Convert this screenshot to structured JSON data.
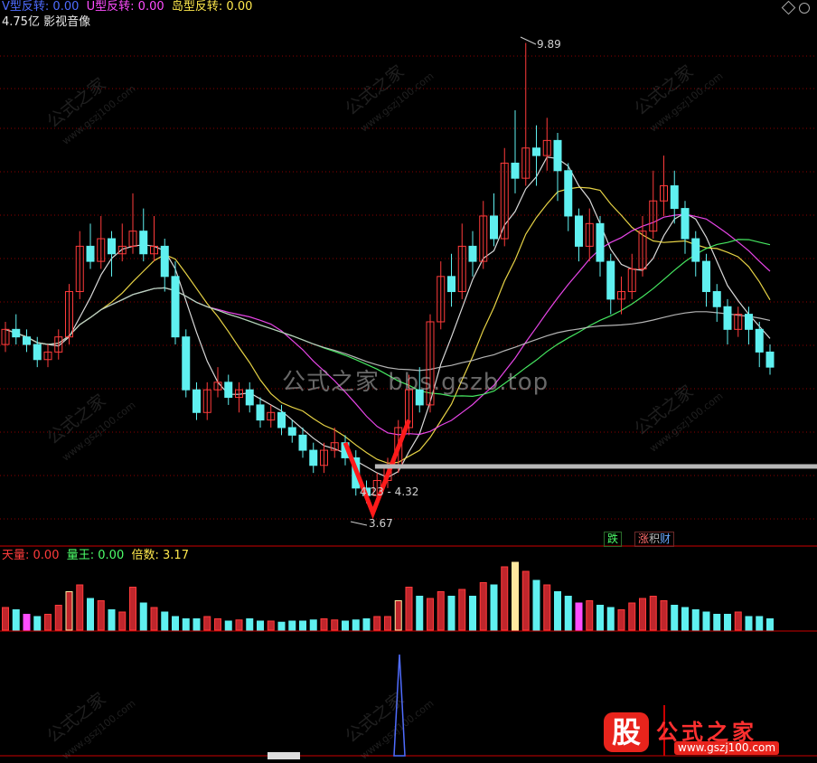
{
  "indicators": {
    "v_label": "V型反转",
    "v_value": "0.00",
    "u_label": "U型反转",
    "u_value": "0.00",
    "island_label": "岛型反转",
    "island_value": "0.00"
  },
  "cap_info": "4.75亿 影视音像",
  "price_high_label": "9.89",
  "price_range_label": "4.23 - 4.32",
  "price_low_label": "3.67",
  "signal_tags": {
    "die": "跌",
    "zzc_red": "涨",
    "zzc_mid": "积",
    "zzc_blue": "财"
  },
  "volume_indicators": {
    "tianliang_label": "天量",
    "tianliang_value": "0.00",
    "liangwang_label": "量王",
    "liangwang_value": "0.00",
    "beishu_label": "倍数",
    "beishu_value": "3.17"
  },
  "watermarks": {
    "center": "公式之家 bbs.gszb.top",
    "tile_cn": "公式之家",
    "tile_url": "www.gszj100.com"
  },
  "logo": {
    "icon_char": "股",
    "name": "公式之家",
    "url": "www.gszj100.com"
  },
  "colors": {
    "up": "#ff3b3b",
    "down": "#5ff0f0",
    "ma5": "#f0f0f0",
    "ma10": "#ffe94d",
    "ma20": "#ff4dff",
    "ma30": "#4dff6a",
    "ma60": "#c8c8c8",
    "grid": "#8b0000",
    "v_mark": "#ff1a1a",
    "blue": "#4f6cff"
  },
  "chart_data": {
    "type": "candlestick",
    "price_range": [
      3.4,
      10.1
    ],
    "candles": [
      [
        5.9,
        6.1,
        6.2,
        5.8
      ],
      [
        6.1,
        6.0,
        6.3,
        5.9
      ],
      [
        6.0,
        5.9,
        6.1,
        5.8
      ],
      [
        5.9,
        5.7,
        6.0,
        5.6
      ],
      [
        5.7,
        5.8,
        5.9,
        5.6
      ],
      [
        5.8,
        6.0,
        6.1,
        5.7
      ],
      [
        6.0,
        6.6,
        6.7,
        5.9
      ],
      [
        6.6,
        7.2,
        7.4,
        6.5
      ],
      [
        7.2,
        7.0,
        7.5,
        6.9
      ],
      [
        7.0,
        7.3,
        7.6,
        6.9
      ],
      [
        7.3,
        7.1,
        7.4,
        6.8
      ],
      [
        7.1,
        7.2,
        7.5,
        7.0
      ],
      [
        7.2,
        7.4,
        7.9,
        7.1
      ],
      [
        7.4,
        7.1,
        7.7,
        7.0
      ],
      [
        7.1,
        7.2,
        7.6,
        7.0
      ],
      [
        7.2,
        6.8,
        7.3,
        6.6
      ],
      [
        6.8,
        6.0,
        7.0,
        5.9
      ],
      [
        6.0,
        5.3,
        6.1,
        5.2
      ],
      [
        5.3,
        5.0,
        5.4,
        4.9
      ],
      [
        5.0,
        5.3,
        5.4,
        4.9
      ],
      [
        5.3,
        5.4,
        5.6,
        5.2
      ],
      [
        5.4,
        5.2,
        5.5,
        5.1
      ],
      [
        5.2,
        5.3,
        5.4,
        5.0
      ],
      [
        5.3,
        5.1,
        5.4,
        5.0
      ],
      [
        5.1,
        4.9,
        5.2,
        4.8
      ],
      [
        4.9,
        5.0,
        5.1,
        4.8
      ],
      [
        5.0,
        4.8,
        5.1,
        4.7
      ],
      [
        4.8,
        4.7,
        4.9,
        4.6
      ],
      [
        4.7,
        4.5,
        4.8,
        4.4
      ],
      [
        4.5,
        4.3,
        4.6,
        4.2
      ],
      [
        4.3,
        4.5,
        4.6,
        4.2
      ],
      [
        4.5,
        4.6,
        4.8,
        4.4
      ],
      [
        4.6,
        4.4,
        4.7,
        4.3
      ],
      [
        4.4,
        4.0,
        4.5,
        3.9
      ],
      [
        4.0,
        3.9,
        4.1,
        3.8
      ],
      [
        3.9,
        4.1,
        4.2,
        3.8
      ],
      [
        4.1,
        4.3,
        4.4,
        4.0
      ],
      [
        4.3,
        4.8,
        4.9,
        4.2
      ],
      [
        4.8,
        5.3,
        5.5,
        4.7
      ],
      [
        5.3,
        5.1,
        5.6,
        5.0
      ],
      [
        5.1,
        6.2,
        6.3,
        5.0
      ],
      [
        6.2,
        6.8,
        7.0,
        6.1
      ],
      [
        6.8,
        6.6,
        7.1,
        6.4
      ],
      [
        6.6,
        7.2,
        7.5,
        6.5
      ],
      [
        7.2,
        7.0,
        7.4,
        6.8
      ],
      [
        7.0,
        7.6,
        7.8,
        6.9
      ],
      [
        7.6,
        7.3,
        7.9,
        7.2
      ],
      [
        7.3,
        8.3,
        8.5,
        7.2
      ],
      [
        8.3,
        8.1,
        9.0,
        7.9
      ],
      [
        8.1,
        8.5,
        9.89,
        8.0
      ],
      [
        8.5,
        8.4,
        8.8,
        8.0
      ],
      [
        8.4,
        8.6,
        8.9,
        8.2
      ],
      [
        8.6,
        8.2,
        8.7,
        7.8
      ],
      [
        8.2,
        7.6,
        8.3,
        7.4
      ],
      [
        7.6,
        7.2,
        7.7,
        7.0
      ],
      [
        7.2,
        7.5,
        7.7,
        7.0
      ],
      [
        7.5,
        7.0,
        7.6,
        6.8
      ],
      [
        7.0,
        6.5,
        7.1,
        6.3
      ],
      [
        6.5,
        6.6,
        6.8,
        6.3
      ],
      [
        6.6,
        6.9,
        7.1,
        6.5
      ],
      [
        6.9,
        7.4,
        7.6,
        6.8
      ],
      [
        7.4,
        7.8,
        8.2,
        7.3
      ],
      [
        7.8,
        8.0,
        8.4,
        7.6
      ],
      [
        8.0,
        7.7,
        8.2,
        7.5
      ],
      [
        7.7,
        7.3,
        7.8,
        7.1
      ],
      [
        7.3,
        7.0,
        7.4,
        6.8
      ],
      [
        7.0,
        6.6,
        7.1,
        6.4
      ],
      [
        6.6,
        6.4,
        6.7,
        6.2
      ],
      [
        6.4,
        6.1,
        6.5,
        5.9
      ],
      [
        6.1,
        6.3,
        6.4,
        6.0
      ],
      [
        6.3,
        6.1,
        6.4,
        5.9
      ],
      [
        6.1,
        5.8,
        6.2,
        5.6
      ],
      [
        5.8,
        5.6,
        5.9,
        5.5
      ]
    ],
    "volumes": [
      20,
      18,
      14,
      12,
      14,
      22,
      34,
      40,
      28,
      26,
      18,
      16,
      38,
      24,
      20,
      16,
      12,
      10,
      10,
      12,
      10,
      8,
      9,
      10,
      8,
      8,
      7,
      8,
      8,
      9,
      10,
      9,
      8,
      9,
      10,
      12,
      12,
      26,
      38,
      30,
      28,
      34,
      30,
      36,
      30,
      42,
      40,
      56,
      60,
      52,
      44,
      40,
      34,
      30,
      24,
      26,
      22,
      20,
      18,
      24,
      28,
      30,
      26,
      22,
      20,
      18,
      16,
      14,
      14,
      16,
      12,
      12,
      10
    ],
    "v_reversal": {
      "left": [
        32,
        4.6
      ],
      "bottom": [
        34.6,
        3.67
      ],
      "right": [
        38,
        4.9
      ]
    },
    "support_line": {
      "start_index": 34.8,
      "value": 4.28
    }
  }
}
